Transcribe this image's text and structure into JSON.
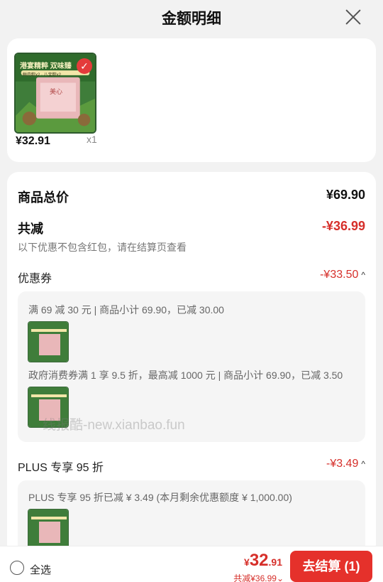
{
  "header": {
    "title": "金额明细"
  },
  "product": {
    "price": "¥32.91",
    "qty": "x1",
    "img_text_main": "港宴精粹 双味臻",
    "img_text_sub": "鲜肉粽x2 · 八宝粽x2",
    "img_brand": "美心",
    "check": "✓"
  },
  "summary": {
    "goods_total_label": "商品总价",
    "goods_total_value": "¥69.90",
    "reduce_label": "共减",
    "reduce_value": "-¥36.99",
    "note": "以下优惠不包含红包，请在结算页查看"
  },
  "coupon": {
    "label": "优惠券",
    "value": "-¥33.50",
    "chevron": "^",
    "items": [
      "满 69 减 30 元 | 商品小计 69.90，已减 30.00",
      "政府消费券满 1 享 9.5 折，最高减 1000 元 | 商品小计 69.90，已减 3.50"
    ]
  },
  "watermark": "线报酷-new.xianbao.fun",
  "plus": {
    "label": "PLUS 专享 95 折",
    "value": "-¥3.49",
    "chevron": "^",
    "detail": "PLUS 专享 95 折已减 ¥ 3.49 (本月剩余优惠额度 ¥ 1,000.00)"
  },
  "bottom": {
    "select_all": "全选",
    "currency": "¥",
    "total_int": "32",
    "total_dec": ".91",
    "reduced": "共减¥36.99",
    "reduced_chev": "⌄",
    "checkout": "去结算 (1)"
  },
  "colors": {
    "accent": "#e5312b",
    "price_red": "#d62f2a",
    "page_bg": "#f2f2f2"
  }
}
